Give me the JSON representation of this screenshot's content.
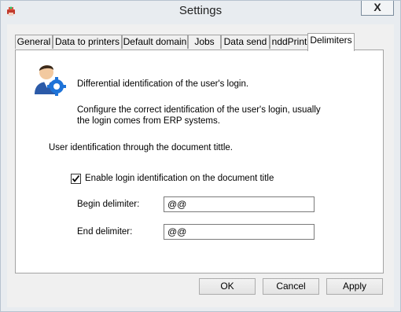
{
  "window": {
    "title": "Settings",
    "close_label": "X"
  },
  "tabs": [
    {
      "label": "General"
    },
    {
      "label": "Data to printers"
    },
    {
      "label": "Default domain"
    },
    {
      "label": "Jobs"
    },
    {
      "label": "Data send"
    },
    {
      "label": "nddPrint"
    },
    {
      "label": "Delimiters"
    }
  ],
  "active_tab": "Delimiters",
  "panel": {
    "heading": "Differential identification of the user's login.",
    "desc_line1": "Configure the correct identification of the user's login, usually",
    "desc_line2": "the login comes from ERP systems.",
    "section": "User identification through the document tittle.",
    "checkbox_label": "Enable login identification on the document title",
    "checkbox_checked": true,
    "begin_label": "Begin delimiter:",
    "begin_value": "@@",
    "end_label": "End delimiter:",
    "end_value": "@@"
  },
  "buttons": {
    "ok": "OK",
    "cancel": "Cancel",
    "apply": "Apply"
  },
  "icons": {
    "app": "printer-icon",
    "user": "user-settings-icon"
  }
}
